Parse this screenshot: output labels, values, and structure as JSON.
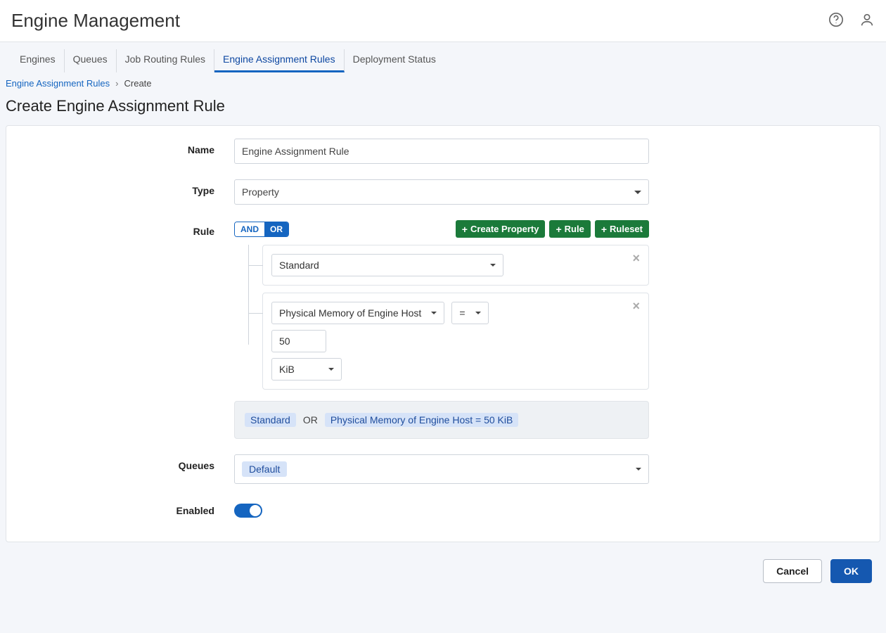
{
  "header": {
    "title": "Engine Management"
  },
  "tabs": [
    {
      "label": "Engines",
      "active": false
    },
    {
      "label": "Queues",
      "active": false
    },
    {
      "label": "Job Routing Rules",
      "active": false
    },
    {
      "label": "Engine Assignment Rules",
      "active": true
    },
    {
      "label": "Deployment Status",
      "active": false
    }
  ],
  "breadcrumb": {
    "parent": "Engine Assignment Rules",
    "sep": "›",
    "current": "Create"
  },
  "page": {
    "title": "Create Engine Assignment Rule"
  },
  "form": {
    "labels": {
      "name": "Name",
      "type": "Type",
      "rule": "Rule",
      "queues": "Queues",
      "enabled": "Enabled"
    },
    "name_value": "Engine Assignment Rule",
    "type_value": "Property",
    "rule_toggle": {
      "and": "AND",
      "or": "OR",
      "selected": "OR"
    },
    "action_buttons": {
      "create_property": "Create Property",
      "rule": "Rule",
      "ruleset": "Ruleset"
    },
    "rule_nodes": {
      "node1": {
        "property_select": "Standard"
      },
      "node2": {
        "attribute": "Physical Memory of Engine Host",
        "operator": "=",
        "value": "50",
        "unit": "KiB"
      }
    },
    "summary": {
      "chip1": "Standard",
      "connector": "OR",
      "chip2": "Physical Memory of Engine Host = 50 KiB"
    },
    "queues_value": "Default",
    "enabled": true
  },
  "footer": {
    "cancel": "Cancel",
    "ok": "OK"
  }
}
